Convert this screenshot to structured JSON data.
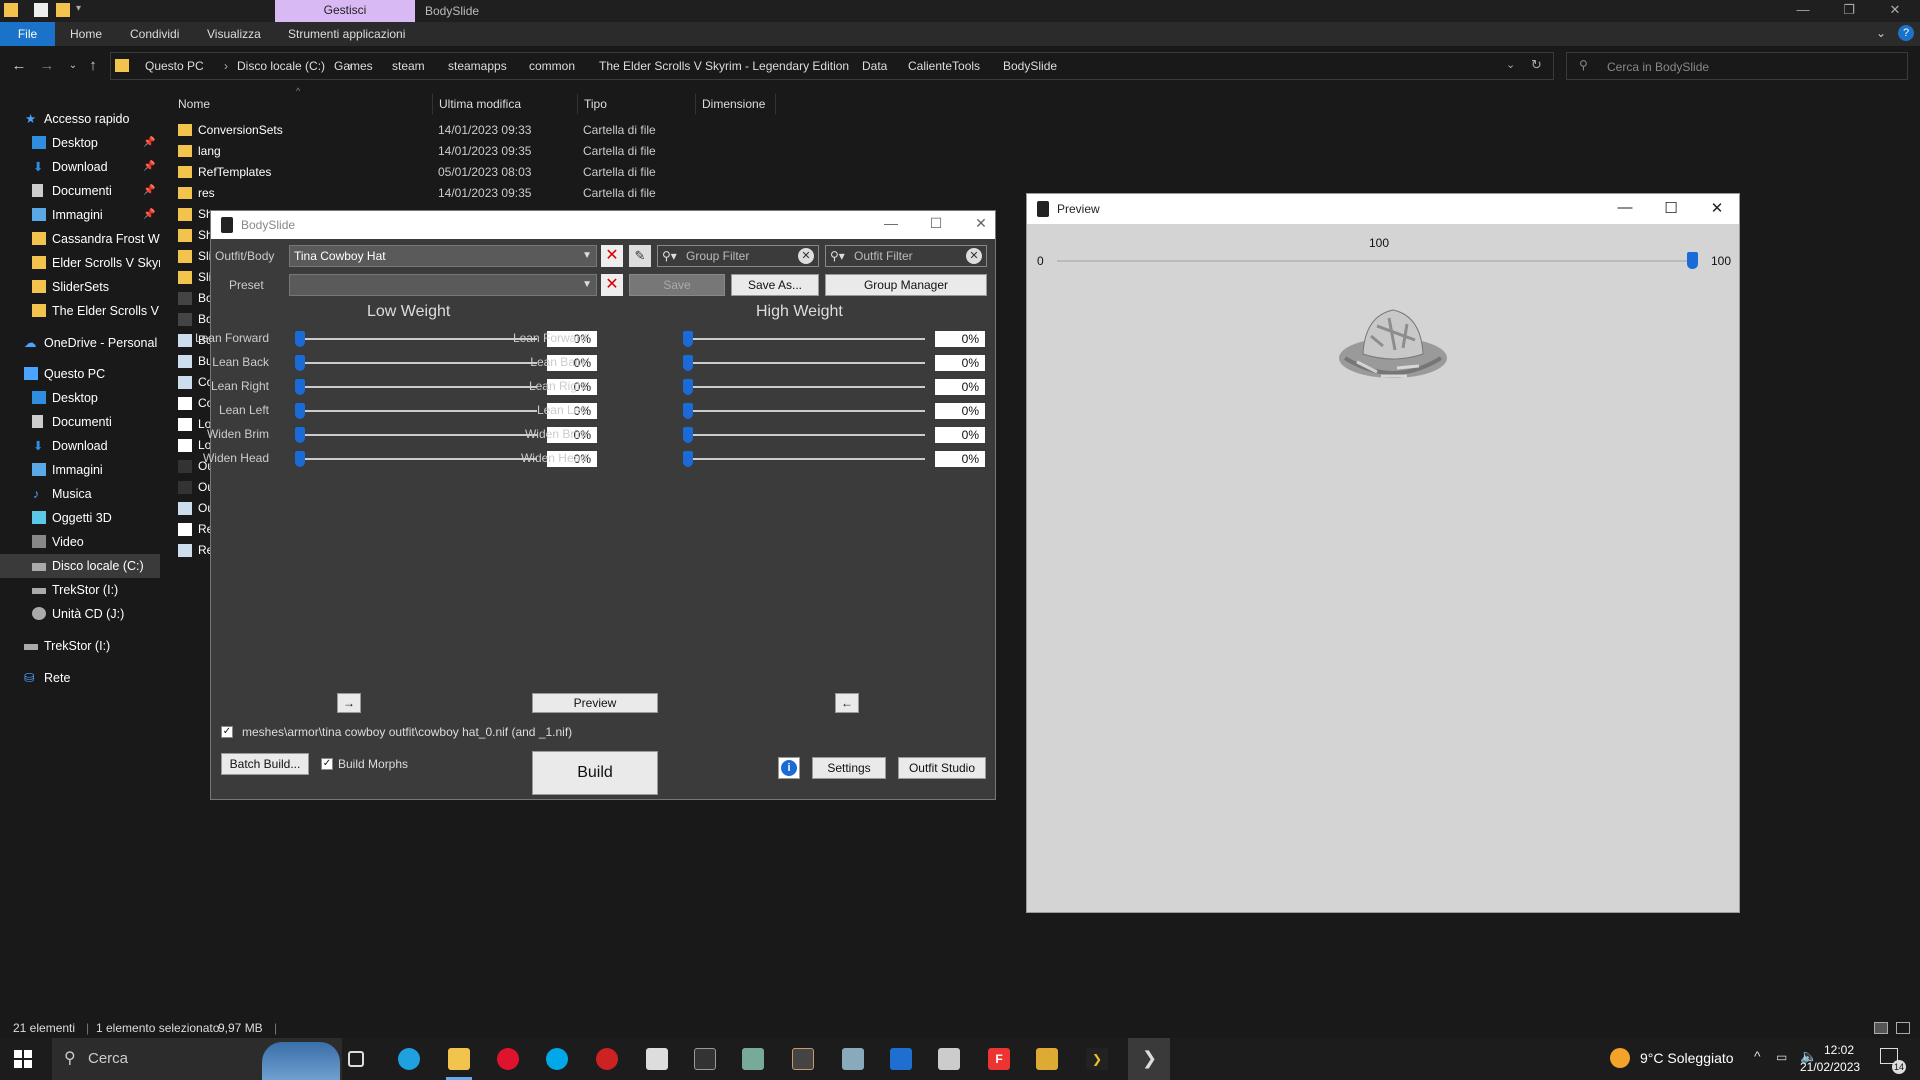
{
  "explorer": {
    "ribbon_context_tab": "Gestisci",
    "window_title": "BodySlide",
    "ribbon_tabs": [
      "File",
      "Home",
      "Condividi",
      "Visualizza",
      "Strumenti applicazioni"
    ],
    "breadcrumbs": [
      "Questo PC",
      "Disco locale (C:)",
      "Games",
      "steam",
      "steamapps",
      "common",
      "The Elder Scrolls V Skyrim - Legendary Edition",
      "Data",
      "CalienteTools",
      "BodySlide"
    ],
    "search_placeholder": "Cerca in BodySlide",
    "nav": {
      "quick_access": "Accesso rapido",
      "quick_items": [
        "Desktop",
        "Download",
        "Documenti",
        "Immagini",
        "Cassandra Frost Wit",
        "Elder Scrolls V  Skyri",
        "SliderSets",
        "The Elder Scrolls V S"
      ],
      "onedrive": "OneDrive - Personal",
      "this_pc": "Questo PC",
      "pc_items": [
        "Desktop",
        "Documenti",
        "Download",
        "Immagini",
        "Musica",
        "Oggetti 3D",
        "Video",
        "Disco locale (C:)",
        "TrekStor (I:)",
        "Unità CD (J:)"
      ],
      "trekstor": "TrekStor (I:)",
      "network": "Rete"
    },
    "columns": [
      "Nome",
      "Ultima modifica",
      "Tipo",
      "Dimensione"
    ],
    "files": [
      {
        "name": "ConversionSets",
        "date": "14/01/2023 09:33",
        "type": "Cartella di file"
      },
      {
        "name": "lang",
        "date": "14/01/2023 09:35",
        "type": "Cartella di file"
      },
      {
        "name": "RefTemplates",
        "date": "05/01/2023 08:03",
        "type": "Cartella di file"
      },
      {
        "name": "res",
        "date": "14/01/2023 09:35",
        "type": "Cartella di file"
      }
    ],
    "clipped_names": [
      "Sh",
      "Sh",
      "Sli",
      "Sli",
      "Bo",
      "Bo",
      "Bo",
      "Bu",
      "Co",
      "Co",
      "Lo",
      "Lo",
      "Ou",
      "Ou",
      "Ou",
      "Re",
      "Re"
    ],
    "status": {
      "count": "21 elementi",
      "selection": "1 elemento selezionato",
      "size": "9,97 MB"
    }
  },
  "bodyslide": {
    "title": "BodySlide",
    "outfit_label": "Outfit/Body",
    "outfit_value": "Tina Cowboy Hat",
    "preset_label": "Preset",
    "preset_value": "",
    "group_filter_placeholder": "Group Filter",
    "outfit_filter_placeholder": "Outfit Filter",
    "save": "Save",
    "save_as": "Save As...",
    "group_manager": "Group Manager",
    "low_weight": "Low Weight",
    "high_weight": "High Weight",
    "sliders": [
      {
        "name": "Lean Forward",
        "low": "0%",
        "high": "0%"
      },
      {
        "name": "Lean Back",
        "low": "0%",
        "high": "0%"
      },
      {
        "name": "Lean Right",
        "low": "0%",
        "high": "0%"
      },
      {
        "name": "Lean Left",
        "low": "0%",
        "high": "0%"
      },
      {
        "name": "Widen Brim",
        "low": "0%",
        "high": "0%"
      },
      {
        "name": "Widen Head",
        "low": "0%",
        "high": "0%"
      }
    ],
    "arrow_right": "→",
    "arrow_left": "←",
    "preview_button": "Preview",
    "mesh_path": "meshes\\armor\\tina cowboy outfit\\cowboy hat_0.nif (and _1.nif)",
    "batch_build": "Batch Build...",
    "build_morphs": "Build Morphs",
    "build": "Build",
    "settings": "Settings",
    "outfit_studio": "Outfit Studio"
  },
  "preview": {
    "title": "Preview",
    "slider_min": "0",
    "slider_max": "100",
    "slider_value": "100",
    "slider_fraction": 1.0
  },
  "taskbar": {
    "search": "Cerca",
    "weather": "9°C Soleggiato",
    "time": "12:02",
    "date": "21/02/2023",
    "notifications": "14"
  }
}
